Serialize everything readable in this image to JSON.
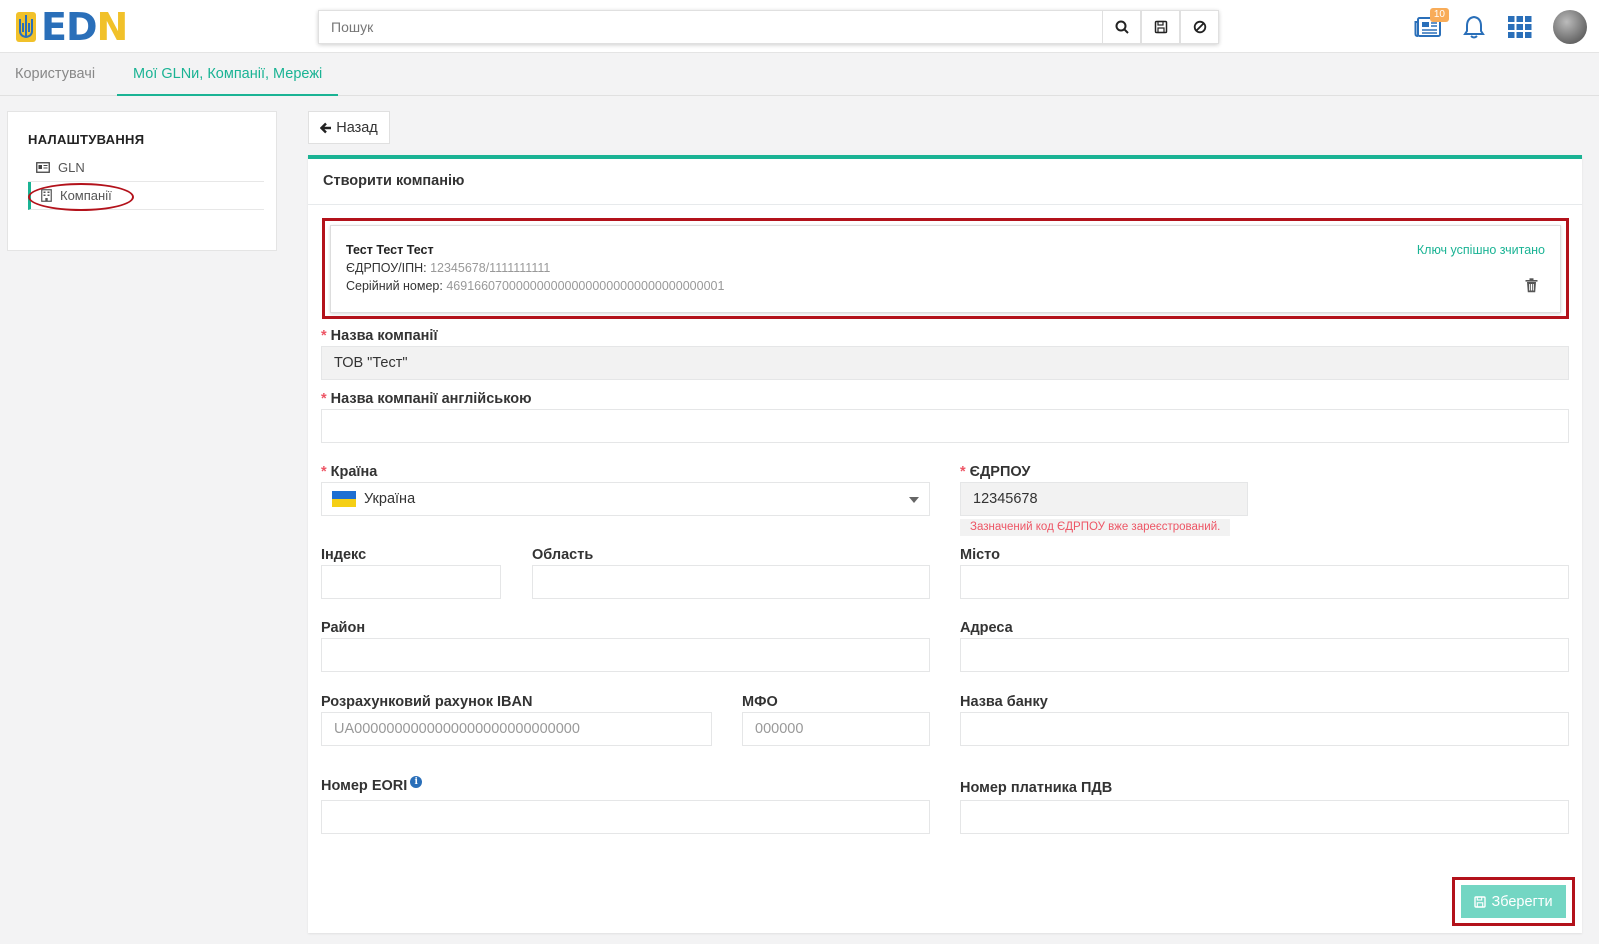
{
  "header": {
    "logo": {
      "letters_blue": "ED",
      "letters_yellow": "N"
    },
    "search": {
      "placeholder": "Пошук"
    },
    "news_badge": "10"
  },
  "tabs": [
    {
      "label": "Користувачі",
      "active": false
    },
    {
      "label": "Мої GLNи, Компанії, Мережі",
      "active": true
    }
  ],
  "sidebar": {
    "title": "НАЛАШТУВАННЯ",
    "items": [
      {
        "label": "GLN",
        "icon": "id-card-icon"
      },
      {
        "label": "Компанії",
        "icon": "building-icon",
        "active": true
      }
    ]
  },
  "back_label": "Назад",
  "form": {
    "title": "Створити компанію",
    "key": {
      "owner": "Тест Тест Тест",
      "edrpou_label": "ЄДРПОУ/ІПН:",
      "edrpou_value": "12345678/1111111111",
      "serial_label": "Серійний номер:",
      "serial_value": "4691660700000000000000000000000000000001",
      "status": "Ключ успішно зчитано"
    },
    "company_name": {
      "label": "Назва компанії",
      "value": "ТОВ \"Тест\""
    },
    "company_name_en": {
      "label": "Назва компанії англійською",
      "value": ""
    },
    "country": {
      "label": "Країна",
      "value": "Україна"
    },
    "edrpou": {
      "label": "ЄДРПОУ",
      "value": "12345678",
      "error": "Зазначений код ЄДРПОУ вже зареєстрований."
    },
    "index": {
      "label": "Індекс",
      "value": ""
    },
    "region": {
      "label": "Область",
      "value": ""
    },
    "city": {
      "label": "Місто",
      "value": ""
    },
    "district": {
      "label": "Район",
      "value": ""
    },
    "address": {
      "label": "Адреса",
      "value": ""
    },
    "iban": {
      "label": "Розрахунковий рахунок IBAN",
      "placeholder": "UA0000000000000000000000000000"
    },
    "mfo": {
      "label": "МФО",
      "placeholder": "000000"
    },
    "bank": {
      "label": "Назва банку",
      "value": ""
    },
    "eori": {
      "label": "Номер EORI",
      "value": ""
    },
    "vat": {
      "label": "Номер платника ПДВ",
      "value": ""
    },
    "save_label": "Зберегти"
  },
  "colors": {
    "accent": "#1ab394",
    "highlight": "#b3121b",
    "error": "#ed5565",
    "brand_blue": "#2a6fb9",
    "brand_yellow": "#f1c12a"
  }
}
